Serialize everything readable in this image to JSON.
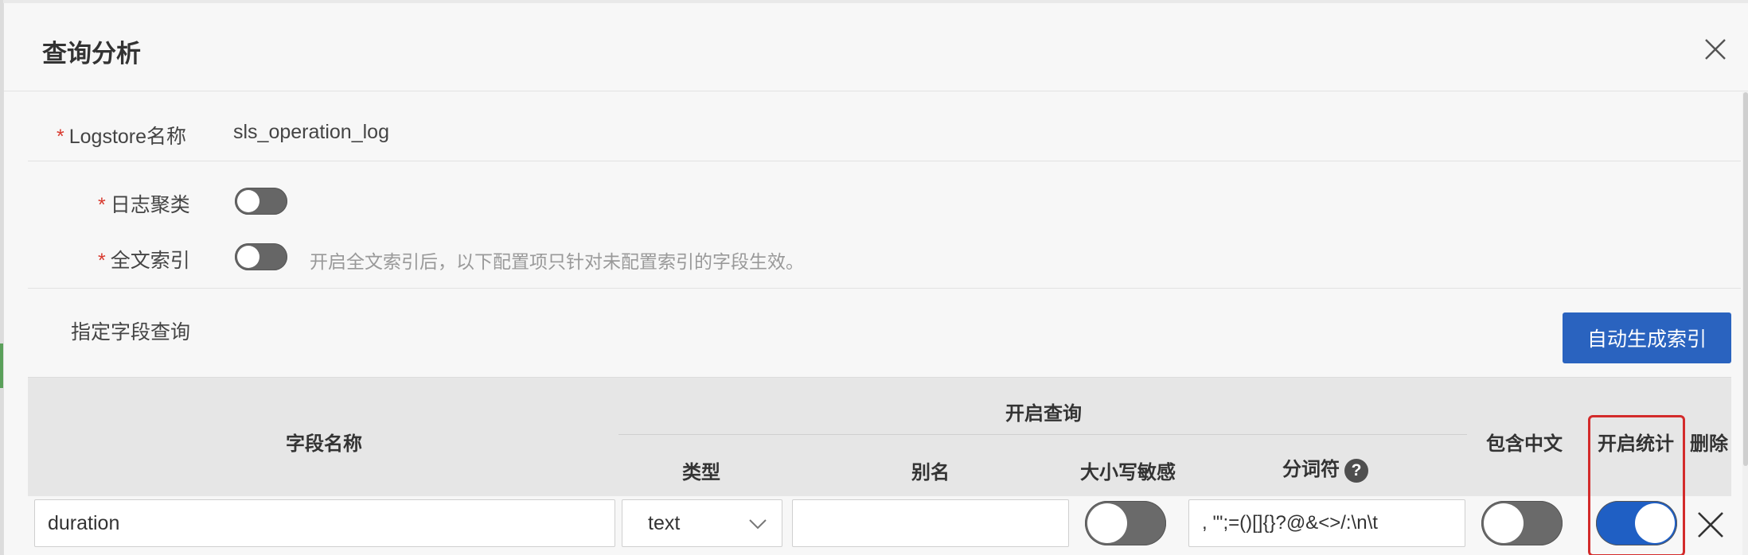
{
  "dialog": {
    "title": "查询分析"
  },
  "form": {
    "logstore_label": "Logstore名称",
    "logstore_value": "sls_operation_log",
    "log_cluster_label": "日志聚类",
    "log_cluster_enabled": false,
    "fulltext_label": "全文索引",
    "fulltext_enabled": false,
    "fulltext_hint": "开启全文索引后，以下配置项只针对未配置索引的字段生效。",
    "field_query_label": "指定字段查询",
    "required_mark": "*",
    "auto_index_button": "自动生成索引"
  },
  "table": {
    "headers": {
      "field_name": "字段名称",
      "enable_query": "开启查询",
      "type": "类型",
      "alias": "别名",
      "case_sensitive": "大小写敏感",
      "tokenizer": "分词符",
      "include_chinese": "包含中文",
      "enable_stats": "开启统计",
      "delete": "删除"
    },
    "help_glyph": "?",
    "rows": [
      {
        "field_name": "duration",
        "type": "text",
        "alias": "",
        "case_sensitive": false,
        "tokenizer": ", '\";=()[]{}?@&<>/:\\n\\t",
        "include_chinese": false,
        "enable_stats": true
      }
    ]
  },
  "colors": {
    "primary": "#2a63bf",
    "toggle_on": "#1f5fc4",
    "toggle_off": "#666666",
    "required": "#d83a2e",
    "highlight": "#d32b2b"
  }
}
